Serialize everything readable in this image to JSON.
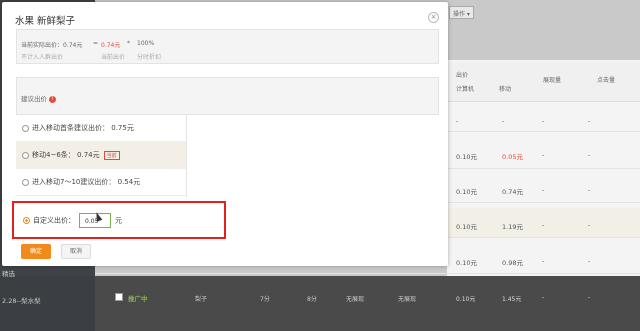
{
  "background": {
    "toolbar_btn": "操作",
    "header": {
      "col1": "出价",
      "col2": "展现量",
      "col3": "点击量",
      "sub1": "计算机",
      "sub2": "移动"
    },
    "rows": [
      {
        "pc": "-",
        "mobile": "-",
        "a": "-",
        "b": "-"
      },
      {
        "pc": "0.10元",
        "mobile": "0.05元",
        "a": "-",
        "b": "-"
      },
      {
        "pc": "0.10元",
        "mobile": "0.74元",
        "a": "-",
        "b": "-"
      },
      {
        "pc": "0.10元",
        "mobile": "1.19元",
        "a": "-",
        "b": "-"
      },
      {
        "pc": "0.10元",
        "mobile": "0.98元",
        "a": "-",
        "b": "-"
      },
      {
        "pc": "0.10元",
        "mobile": "1.45元",
        "a": "-",
        "b": "-"
      }
    ],
    "bottom_row": {
      "status": "推广中",
      "name": "梨子",
      "c1": "7分",
      "c2": "8分",
      "c3": "无展现",
      "c4": "无展现"
    },
    "left_items": [
      "精选",
      "2.28--梨水梨"
    ]
  },
  "modal": {
    "title": "水果 新鲜梨子",
    "close": "×",
    "formula": {
      "line1_a": "当前实际出价：0.74元",
      "line1_eq": "=",
      "line1_b": "0.74元",
      "line1_x": "*",
      "line1_c": "100%",
      "line2_a": "不计入人群出价",
      "line2_b": "当前出价",
      "line2_c": "分时折扣"
    },
    "suggest_label": "建议出价",
    "options": [
      {
        "label": "进入移动首条建议出价：",
        "value": "0.75元"
      },
      {
        "label": "移动4~6条：",
        "value": "0.74元",
        "badge": "当前"
      },
      {
        "label": "进入移动7～10建议出价：",
        "value": "0.54元"
      }
    ],
    "custom_label": "自定义出价：",
    "custom_value": "0.05",
    "custom_unit": "元",
    "ok": "确定",
    "cancel": "取消"
  }
}
